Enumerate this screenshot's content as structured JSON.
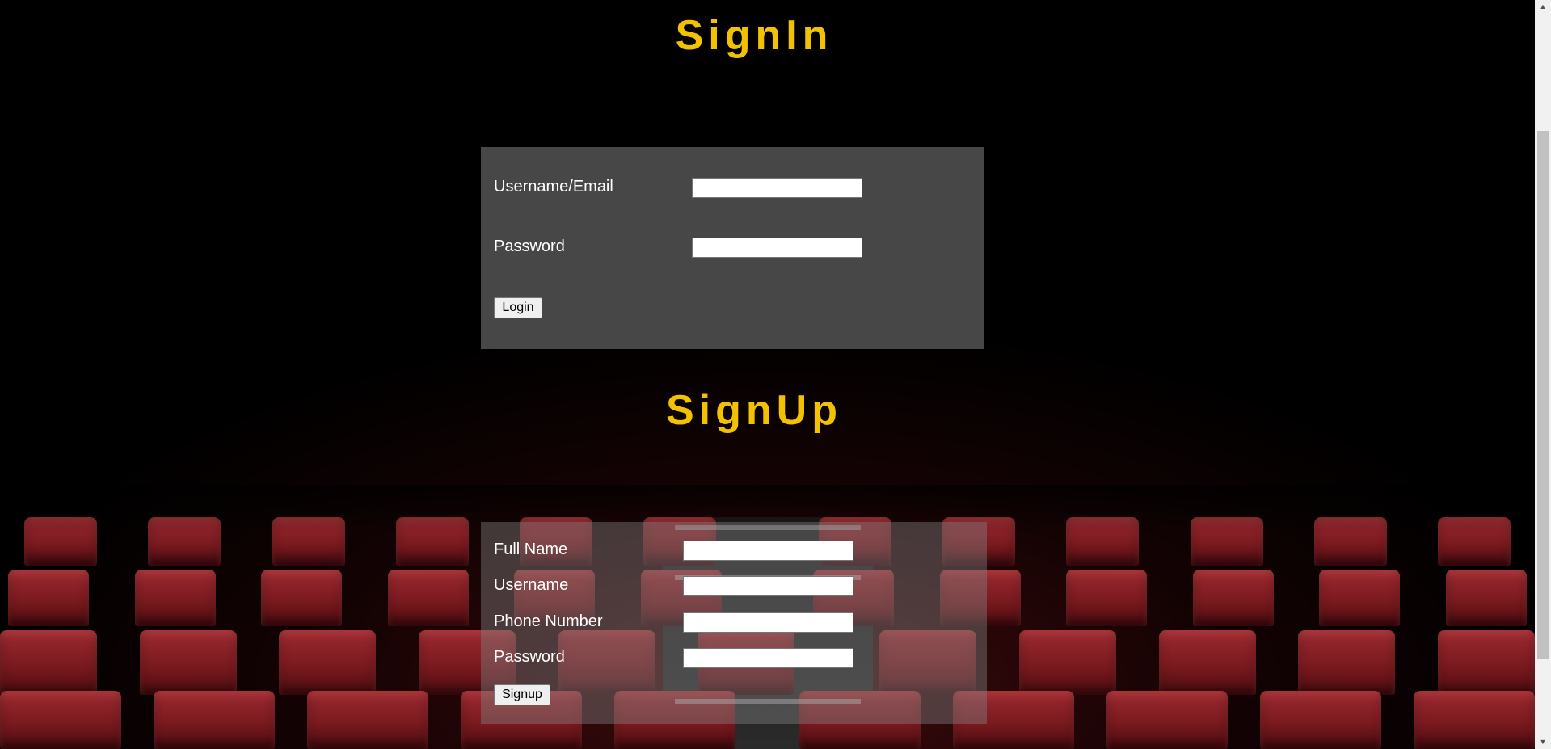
{
  "signin": {
    "title": "SignIn",
    "fields": [
      {
        "label": "Username/Email",
        "value": "",
        "placeholder": ""
      },
      {
        "label": "Password",
        "value": "",
        "placeholder": ""
      }
    ],
    "button_label": "Login"
  },
  "signup": {
    "title": "SignUp",
    "fields": [
      {
        "label": "Full Name",
        "value": "",
        "placeholder": ""
      },
      {
        "label": "Username",
        "value": "",
        "placeholder": ""
      },
      {
        "label": "Phone Number",
        "value": "",
        "placeholder": ""
      },
      {
        "label": "Password",
        "value": "",
        "placeholder": ""
      }
    ],
    "button_label": "Signup"
  },
  "colors": {
    "heading": "#f2c200",
    "signin_panel": "#474747",
    "page_background": "#000000",
    "seat": "#8c2228"
  },
  "scrollbar": {
    "up_icon": "triangle-up-icon",
    "down_icon": "triangle-down-icon"
  }
}
